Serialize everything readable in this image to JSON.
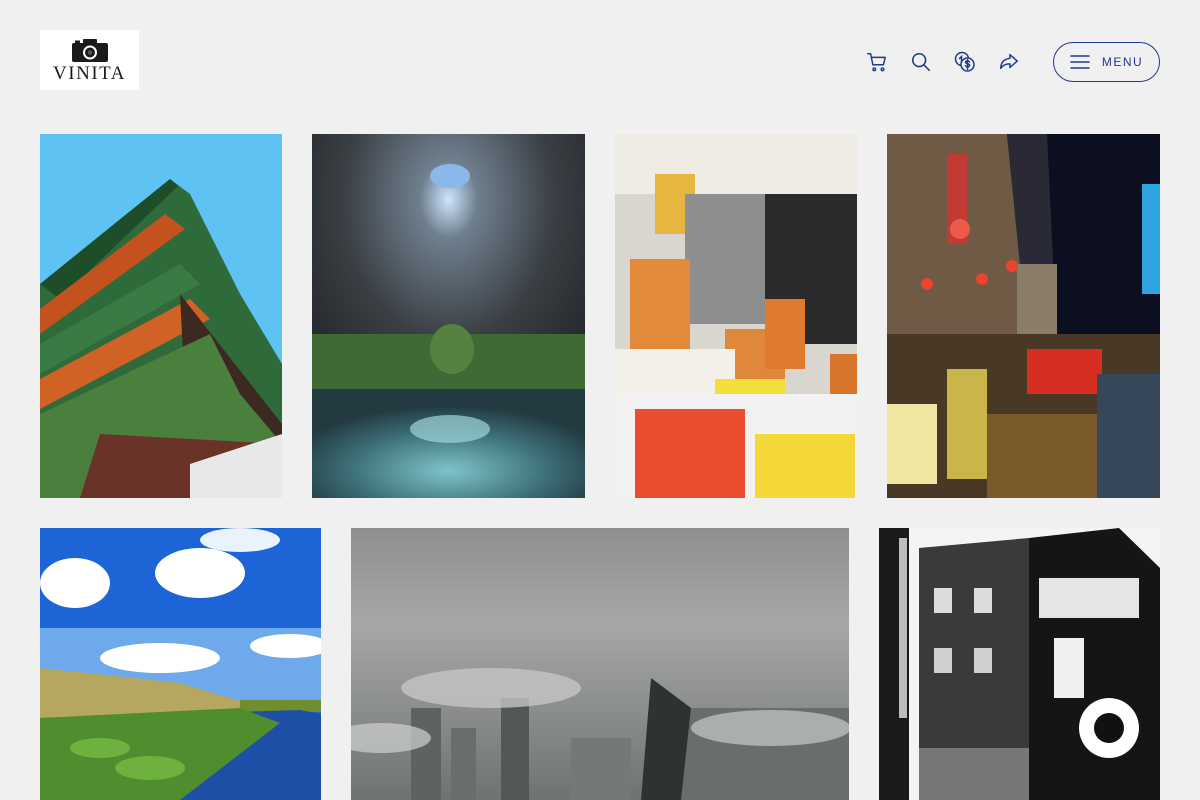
{
  "header": {
    "logo_text": "VINITA",
    "icons": [
      "cart-icon",
      "search-icon",
      "currency-icon",
      "share-icon",
      "hamburger-icon"
    ],
    "menu_label": "MENU"
  },
  "colors": {
    "background": "#f0f0f0",
    "accent": "#1f3a8a"
  },
  "gallery": {
    "photos": [
      {
        "subject": "korean-palace-roof"
      },
      {
        "subject": "hive-sculpture"
      },
      {
        "subject": "dim-sum-food-stall"
      },
      {
        "subject": "night-market-street"
      },
      {
        "subject": "wetland-lilypads-sky"
      },
      {
        "subject": "city-skyline-fog"
      },
      {
        "subject": "graffiti-building-bw"
      }
    ]
  }
}
